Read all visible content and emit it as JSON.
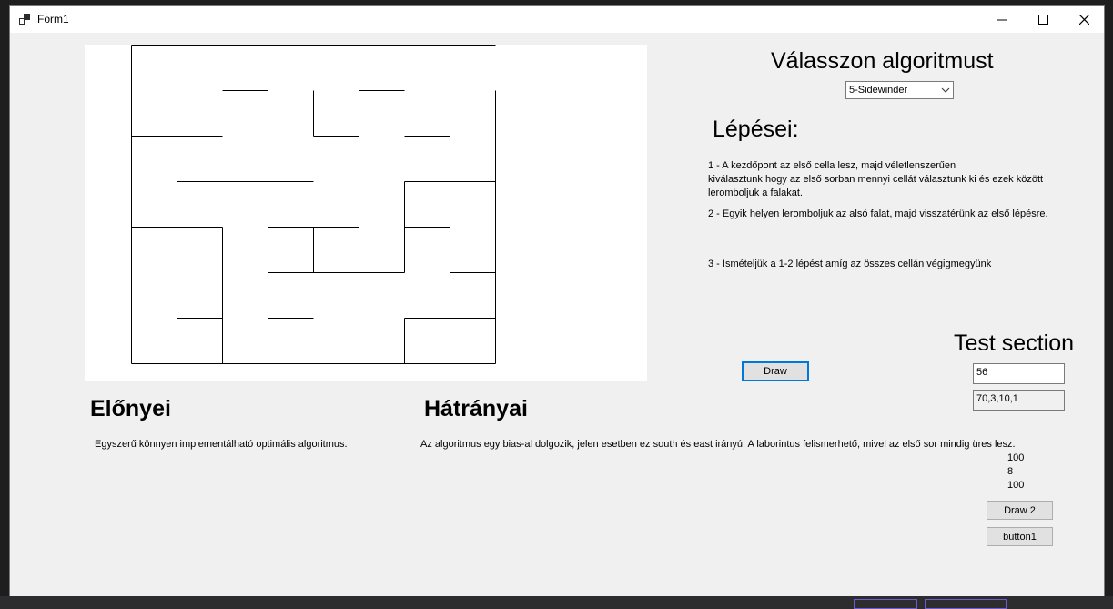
{
  "window": {
    "title": "Form1",
    "minimize_icon": "minimize-icon",
    "maximize_icon": "maximize-icon",
    "close_icon": "close-icon"
  },
  "algorithm": {
    "heading": "Válasszon algoritmust",
    "selected": "5-Sidewinder"
  },
  "steps": {
    "heading": "Lépései:",
    "step1": "1 - A kezdőpont az első cella lesz, majd véletlenszerűen\nkiválasztunk hogy az első sorban mennyi cellát választunk ki és ezek között\nleromboljuk a falakat.",
    "step2": "2 - Egyik helyen leromboljuk az alsó falat, majd visszatérünk az első lépésre.",
    "step3": "3 - Ismételjük a 1-2 lépést amíg az összes cellán végigmegyünk"
  },
  "buttons": {
    "draw": "Draw",
    "draw2": "Draw 2",
    "button1": "button1"
  },
  "test": {
    "heading": "Test section",
    "input1": "56",
    "input2": "70,3,10,1",
    "label1": "100",
    "label2": "8",
    "label3": "100"
  },
  "pros": {
    "heading": "Előnyei",
    "text": "Egyszerű könnyen implementálható optimális algoritmus."
  },
  "cons": {
    "heading": "Hátrányai",
    "text": "Az algoritmus egy bias-al dolgozik, jelen esetben ez south és east irányú. A laborintus felismerhető, mivel az első sor mindig üres lesz."
  },
  "maze": {
    "rows": 7,
    "cols": 8,
    "walls": [
      [
        0,
        0,
        8,
        0
      ],
      [
        0,
        0,
        0,
        7
      ],
      [
        8,
        1,
        8,
        7
      ],
      [
        0,
        7,
        8,
        7
      ],
      [
        1,
        1,
        1,
        2
      ],
      [
        1,
        2,
        2,
        2
      ],
      [
        2,
        1,
        3,
        1
      ],
      [
        3,
        1,
        3,
        2
      ],
      [
        4,
        1,
        4,
        2
      ],
      [
        4,
        2,
        5,
        2
      ],
      [
        5,
        1,
        6,
        1
      ],
      [
        5,
        1,
        5,
        2
      ],
      [
        7,
        1,
        7,
        3
      ],
      [
        6,
        2,
        7,
        2
      ],
      [
        0,
        2,
        1,
        2
      ],
      [
        5,
        2,
        5,
        6
      ],
      [
        1,
        3,
        4,
        3
      ],
      [
        6,
        3,
        8,
        3
      ],
      [
        6,
        3,
        6,
        5
      ],
      [
        1,
        4,
        2,
        4
      ],
      [
        2,
        4,
        2,
        6
      ],
      [
        3,
        4,
        5,
        4
      ],
      [
        4,
        4,
        4,
        5
      ],
      [
        6,
        4,
        7,
        4
      ],
      [
        7,
        4,
        7,
        5
      ],
      [
        0,
        4,
        1,
        4
      ],
      [
        3,
        5,
        5,
        5
      ],
      [
        5,
        5,
        6,
        5
      ],
      [
        1,
        5,
        1,
        6
      ],
      [
        1,
        6,
        2,
        6
      ],
      [
        7,
        5,
        8,
        5
      ],
      [
        7,
        5,
        7,
        7
      ],
      [
        3,
        6,
        4,
        6
      ],
      [
        3,
        6,
        3,
        7
      ],
      [
        5,
        6,
        5,
        7
      ],
      [
        6,
        6,
        6,
        7
      ],
      [
        6,
        6,
        8,
        6
      ],
      [
        2,
        6,
        2,
        7
      ]
    ]
  }
}
